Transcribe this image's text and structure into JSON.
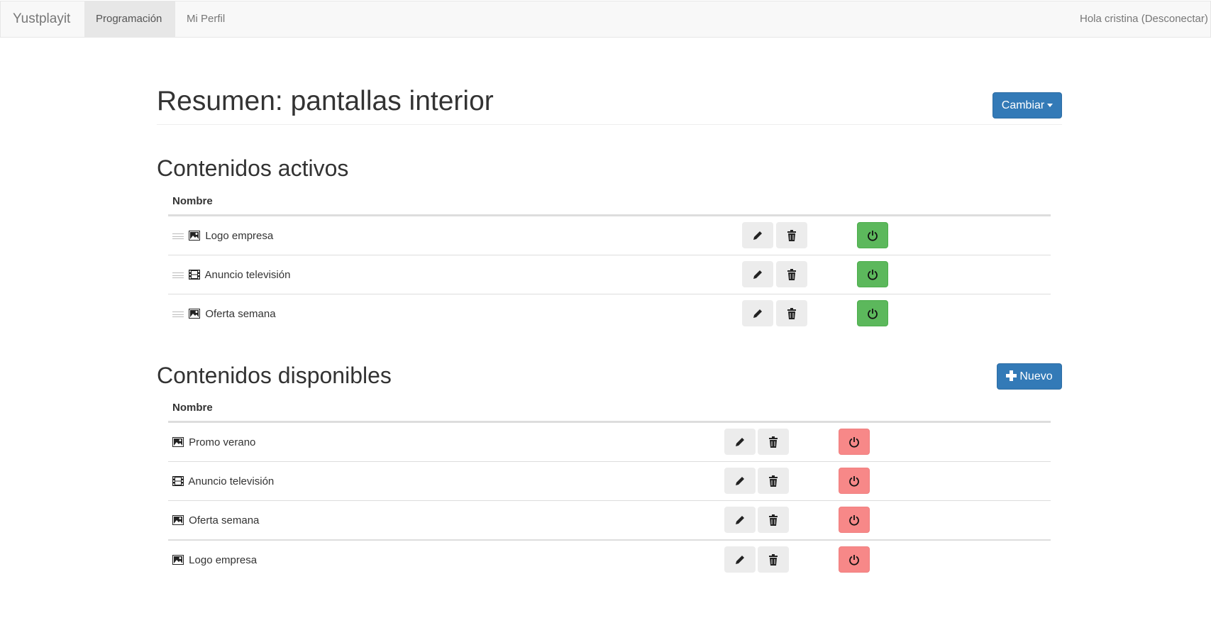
{
  "navbar": {
    "brand": "Yustplayit",
    "items": [
      {
        "label": "Programación",
        "active": true
      },
      {
        "label": "Mi Perfil",
        "active": false
      }
    ],
    "user_text": "Hola cristina (Desconectar)"
  },
  "page": {
    "title": "Resumen: pantallas interior",
    "change_button": "Cambiar"
  },
  "active_section": {
    "title": "Contenidos activos",
    "column_header": "Nombre",
    "rows": [
      {
        "name": "Logo empresa",
        "type": "picture-icon",
        "status": "on"
      },
      {
        "name": "Anuncio televisión",
        "type": "film-icon",
        "status": "on"
      },
      {
        "name": "Oferta semana",
        "type": "picture-icon",
        "status": "on"
      }
    ]
  },
  "available_section": {
    "title": "Contenidos disponibles",
    "new_button": "Nuevo",
    "column_header": "Nombre",
    "rows": [
      {
        "name": "Promo verano",
        "type": "picture-icon",
        "status": "off"
      },
      {
        "name": "Anuncio televisión",
        "type": "film-icon",
        "status": "off"
      },
      {
        "name": "Oferta semana",
        "type": "picture-icon",
        "status": "off"
      },
      {
        "name": "Logo empresa",
        "type": "picture-icon",
        "status": "off"
      }
    ]
  },
  "colors": {
    "primary": "#337ab7",
    "success": "#5cb85c",
    "danger_light": "#f78888",
    "navbar_bg": "#f8f8f8"
  },
  "icons": {
    "edit": "pencil-icon",
    "delete": "trash-icon",
    "toggle": "power-icon",
    "drag": "drag-handle-icon"
  }
}
